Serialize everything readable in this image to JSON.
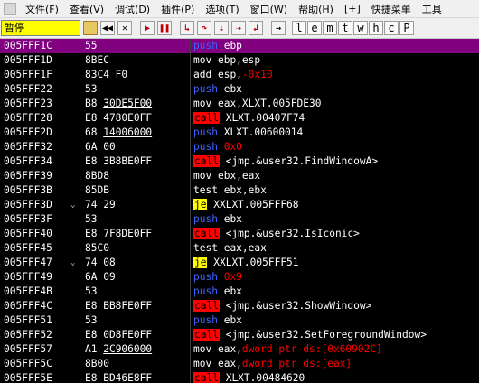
{
  "menu": {
    "items": [
      "文件(F)",
      "查看(V)",
      "调试(D)",
      "插件(P)",
      "选项(T)",
      "窗口(W)",
      "帮助(H)",
      "[+]",
      "快捷菜单",
      "工具"
    ]
  },
  "toolbar": {
    "status_label": "暂停",
    "letter_buttons": [
      "l",
      "e",
      "m",
      "t",
      "w",
      "h",
      "c",
      "P"
    ]
  },
  "disasm": {
    "rows": [
      {
        "addr": "005FFF1C",
        "hex": "55",
        "ul": "",
        "hex_rest": "",
        "mn": "push",
        "op": "ebp",
        "op_class": "",
        "sel": true
      },
      {
        "addr": "005FFF1D",
        "hex": "8BEC",
        "ul": "",
        "hex_rest": "",
        "mn": "mov",
        "op": "ebp,esp",
        "op_class": ""
      },
      {
        "addr": "005FFF1F",
        "hex": "83C4 F0",
        "ul": "",
        "hex_rest": "",
        "mn": "add",
        "op": "esp,-0x10",
        "op_class": "num"
      },
      {
        "addr": "005FFF22",
        "hex": "53",
        "ul": "",
        "hex_rest": "",
        "mn": "push",
        "op": "ebx",
        "op_class": ""
      },
      {
        "addr": "005FFF23",
        "hex": "B8 ",
        "ul": "30DE5F00",
        "hex_rest": "",
        "mn": "mov",
        "op": "eax,XLXT.005FDE30",
        "op_class": ""
      },
      {
        "addr": "005FFF28",
        "hex": "E8 4780E0FF",
        "ul": "",
        "hex_rest": "",
        "mn": "call",
        "op": "XLXT.00407F74",
        "op_class": ""
      },
      {
        "addr": "005FFF2D",
        "hex": "68 ",
        "ul": "14006000",
        "hex_rest": "",
        "mn": "push",
        "op": "XLXT.00600014",
        "op_class": ""
      },
      {
        "addr": "005FFF32",
        "hex": "6A 00",
        "ul": "",
        "hex_rest": "",
        "mn": "push",
        "op": "0x0",
        "op_class": "num"
      },
      {
        "addr": "005FFF34",
        "hex": "E8 3B8BE0FF",
        "ul": "",
        "hex_rest": "",
        "mn": "call",
        "op": "<jmp.&user32.FindWindowA>",
        "op_class": ""
      },
      {
        "addr": "005FFF39",
        "hex": "8BD8",
        "ul": "",
        "hex_rest": "",
        "mn": "mov",
        "op": "ebx,eax",
        "op_class": ""
      },
      {
        "addr": "005FFF3B",
        "hex": "85DB",
        "ul": "",
        "hex_rest": "",
        "mn": "test",
        "op": "ebx,ebx",
        "op_class": ""
      },
      {
        "addr": "005FFF3D",
        "hex": "74 29",
        "ul": "",
        "hex_rest": "",
        "mn": "je",
        "op": "XXLXT.005FFF68",
        "op_class": "",
        "arrow": true
      },
      {
        "addr": "005FFF3F",
        "hex": "53",
        "ul": "",
        "hex_rest": "",
        "mn": "push",
        "op": "ebx",
        "op_class": ""
      },
      {
        "addr": "005FFF40",
        "hex": "E8 7F8DE0FF",
        "ul": "",
        "hex_rest": "",
        "mn": "call",
        "op": "<jmp.&user32.IsIconic>",
        "op_class": ""
      },
      {
        "addr": "005FFF45",
        "hex": "85C0",
        "ul": "",
        "hex_rest": "",
        "mn": "test",
        "op": "eax,eax",
        "op_class": ""
      },
      {
        "addr": "005FFF47",
        "hex": "74 08",
        "ul": "",
        "hex_rest": "",
        "mn": "je",
        "op": "XXLXT.005FFF51",
        "op_class": "",
        "arrow": true
      },
      {
        "addr": "005FFF49",
        "hex": "6A 09",
        "ul": "",
        "hex_rest": "",
        "mn": "push",
        "op": "0x9",
        "op_class": "num"
      },
      {
        "addr": "005FFF4B",
        "hex": "53",
        "ul": "",
        "hex_rest": "",
        "mn": "push",
        "op": "ebx",
        "op_class": ""
      },
      {
        "addr": "005FFF4C",
        "hex": "E8 BB8FE0FF",
        "ul": "",
        "hex_rest": "",
        "mn": "call",
        "op": "<jmp.&user32.ShowWindow>",
        "op_class": ""
      },
      {
        "addr": "005FFF51",
        "hex": "53",
        "ul": "",
        "hex_rest": "",
        "mn": "push",
        "op": "ebx",
        "op_class": ""
      },
      {
        "addr": "005FFF52",
        "hex": "E8 0D8FE0FF",
        "ul": "",
        "hex_rest": "",
        "mn": "call",
        "op": "<jmp.&user32.SetForegroundWindow>",
        "op_class": ""
      },
      {
        "addr": "005FFF57",
        "hex": "A1 ",
        "ul": "2C906000",
        "hex_rest": "",
        "mn": "mov",
        "op": "eax,dword ptr ds:[0x60902C]",
        "op_class": "ptr"
      },
      {
        "addr": "005FFF5C",
        "hex": "8B00",
        "ul": "",
        "hex_rest": "",
        "mn": "mov",
        "op": "eax,dword ptr ds:[eax]",
        "op_class": "ptr"
      },
      {
        "addr": "005FFF5E",
        "hex": "E8 BD46E8FF",
        "ul": "",
        "hex_rest": "",
        "mn": "call",
        "op": "XLXT.00484620",
        "op_class": ""
      }
    ]
  },
  "colors": {
    "selected_row": "#800080",
    "call_bg": "#ff0000",
    "je_bg": "#ffff00",
    "push_fg": "#3c64ff",
    "status_bg": "#ffff00"
  }
}
